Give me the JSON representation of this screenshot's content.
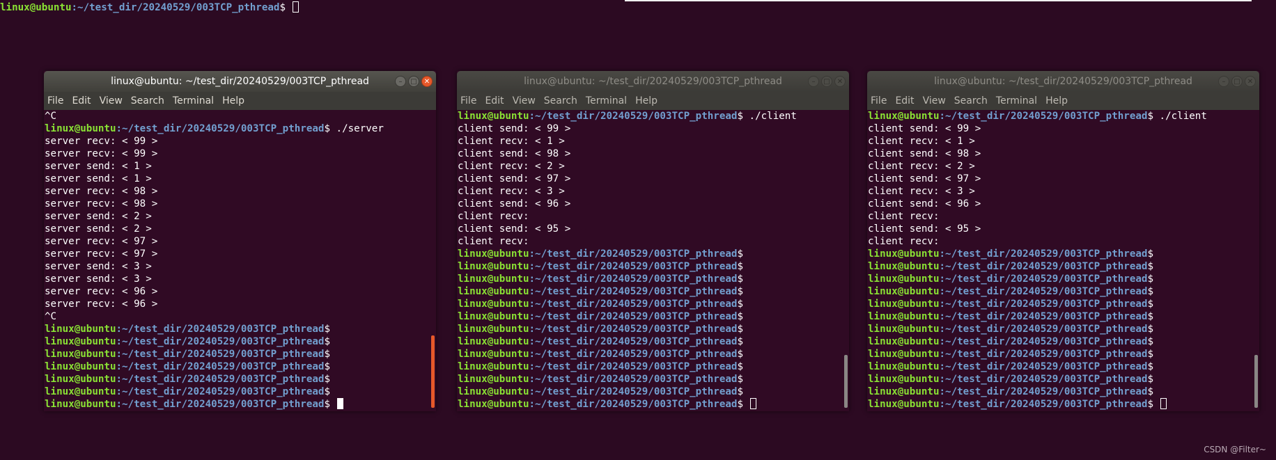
{
  "background_terminal": {
    "user": "linux@ubuntu",
    "path": ":~/test_dir/20240529/003TCP_pthread",
    "symbol": "$ "
  },
  "windows": [
    {
      "title": "linux@ubuntu: ~/test_dir/20240529/003TCP_pthread",
      "menu": [
        "File",
        "Edit",
        "View",
        "Search",
        "Terminal",
        "Help"
      ],
      "lines": [
        {
          "t": "^C"
        },
        {
          "prompt": true,
          "cmd": " ./server"
        },
        {
          "t": "server recv: < 99 >"
        },
        {
          "t": "server recv: < 99 >"
        },
        {
          "t": "server send: < 1 >"
        },
        {
          "t": "server send: < 1 >"
        },
        {
          "t": "server recv: < 98 >"
        },
        {
          "t": "server recv: < 98 >"
        },
        {
          "t": "server send: < 2 >"
        },
        {
          "t": "server send: < 2 >"
        },
        {
          "t": "server recv: < 97 >"
        },
        {
          "t": "server recv: < 97 >"
        },
        {
          "t": "server send: < 3 >"
        },
        {
          "t": "server send: < 3 >"
        },
        {
          "t": "server recv: < 96 >"
        },
        {
          "t": "server recv: < 96 >"
        },
        {
          "t": "^C"
        },
        {
          "prompt": true,
          "cmd": ""
        },
        {
          "prompt": true,
          "cmd": ""
        },
        {
          "prompt": true,
          "cmd": ""
        },
        {
          "prompt": true,
          "cmd": ""
        },
        {
          "prompt": true,
          "cmd": ""
        },
        {
          "prompt": true,
          "cmd": ""
        },
        {
          "prompt": true,
          "cmd": " ",
          "cursor": "solid"
        }
      ]
    },
    {
      "title": "linux@ubuntu: ~/test_dir/20240529/003TCP_pthread",
      "menu": [
        "File",
        "Edit",
        "View",
        "Search",
        "Terminal",
        "Help"
      ],
      "lines": [
        {
          "prompt": true,
          "cmd": " ./client"
        },
        {
          "t": "client send: < 99 >"
        },
        {
          "t": "client recv: < 1 >"
        },
        {
          "t": "client send: < 98 >"
        },
        {
          "t": "client recv: < 2 >"
        },
        {
          "t": "client send: < 97 >"
        },
        {
          "t": "client recv: < 3 >"
        },
        {
          "t": "client send: < 96 >"
        },
        {
          "t": "client recv:"
        },
        {
          "t": "client send: < 95 >"
        },
        {
          "t": "client recv:"
        },
        {
          "prompt": true,
          "cmd": ""
        },
        {
          "prompt": true,
          "cmd": ""
        },
        {
          "prompt": true,
          "cmd": ""
        },
        {
          "prompt": true,
          "cmd": ""
        },
        {
          "prompt": true,
          "cmd": ""
        },
        {
          "prompt": true,
          "cmd": ""
        },
        {
          "prompt": true,
          "cmd": ""
        },
        {
          "prompt": true,
          "cmd": ""
        },
        {
          "prompt": true,
          "cmd": ""
        },
        {
          "prompt": true,
          "cmd": ""
        },
        {
          "prompt": true,
          "cmd": ""
        },
        {
          "prompt": true,
          "cmd": ""
        },
        {
          "prompt": true,
          "cmd": " ",
          "cursor": "hollow"
        }
      ]
    },
    {
      "title": "linux@ubuntu: ~/test_dir/20240529/003TCP_pthread",
      "menu": [
        "File",
        "Edit",
        "View",
        "Search",
        "Terminal",
        "Help"
      ],
      "lines": [
        {
          "prompt": true,
          "cmd": " ./client"
        },
        {
          "t": "client send: < 99 >"
        },
        {
          "t": "client recv: < 1 >"
        },
        {
          "t": "client send: < 98 >"
        },
        {
          "t": "client recv: < 2 >"
        },
        {
          "t": "client send: < 97 >"
        },
        {
          "t": "client recv: < 3 >"
        },
        {
          "t": "client send: < 96 >"
        },
        {
          "t": "client recv:"
        },
        {
          "t": "client send: < 95 >"
        },
        {
          "t": "client recv:"
        },
        {
          "prompt": true,
          "cmd": ""
        },
        {
          "prompt": true,
          "cmd": ""
        },
        {
          "prompt": true,
          "cmd": ""
        },
        {
          "prompt": true,
          "cmd": ""
        },
        {
          "prompt": true,
          "cmd": ""
        },
        {
          "prompt": true,
          "cmd": ""
        },
        {
          "prompt": true,
          "cmd": ""
        },
        {
          "prompt": true,
          "cmd": ""
        },
        {
          "prompt": true,
          "cmd": ""
        },
        {
          "prompt": true,
          "cmd": ""
        },
        {
          "prompt": true,
          "cmd": ""
        },
        {
          "prompt": true,
          "cmd": ""
        },
        {
          "prompt": true,
          "cmd": " ",
          "cursor": "hollow"
        }
      ]
    }
  ],
  "prompt": {
    "user": "linux@ubuntu",
    "path": ":~/test_dir/20240529/003TCP_pthread",
    "symbol": "$"
  },
  "watermark": "CSDN @Filter~",
  "colors": {
    "desktop_bg": "#2c0a22",
    "terminal_bg": "#300a24",
    "prompt_user": "#8ae234",
    "prompt_path": "#729fcf",
    "close_button": "#e6582a",
    "scrollbar_active": "#e6582a",
    "scrollbar_inactive": "#8a8785"
  },
  "icons": [
    "minimize-icon",
    "maximize-icon",
    "close-icon"
  ]
}
